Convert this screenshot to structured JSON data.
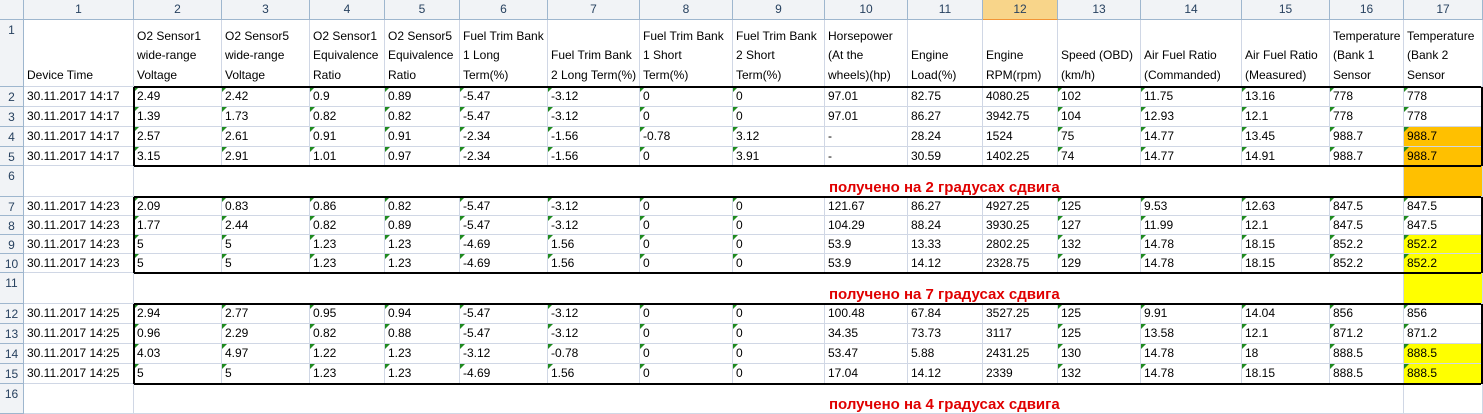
{
  "spreadsheet": {
    "column_numbers": [
      "1",
      "2",
      "3",
      "4",
      "5",
      "6",
      "7",
      "8",
      "9",
      "10",
      "11",
      "12",
      "13",
      "14",
      "15",
      "16",
      "17"
    ],
    "selected_column": "12",
    "row_numbers": [
      "1",
      "2",
      "3",
      "4",
      "5",
      "6",
      "7",
      "8",
      "9",
      "10",
      "11",
      "12",
      "13",
      "14",
      "15",
      "16"
    ],
    "headers": [
      "Device Time",
      "O2 Sensor1 wide-range Voltage",
      "O2 Sensor5 wide-range Voltage",
      "O2 Sensor1 Equivalence Ratio",
      "O2 Sensor5 Equivalence Ratio",
      "Fuel Trim Bank 1 Long Term(%)",
      "Fuel Trim Bank 2 Long Term(%)",
      "Fuel Trim Bank 1 Short Term(%)",
      "Fuel Trim Bank 2 Short Term(%)",
      "Horsepower (At the wheels)(hp)",
      "Engine Load(%)",
      "Engine RPM(rpm)",
      "Speed (OBD) (km/h)",
      "Air Fuel Ratio (Commanded)",
      "Air Fuel Ratio (Measured)",
      "Temperature (Bank 1 Sensor",
      "Temperature (Bank 2 Sensor"
    ],
    "data_rows": [
      {
        "row": "2",
        "cells": [
          "30.11.2017 14:17",
          "2.49",
          "2.42",
          "0.9",
          "0.89",
          "-5.47",
          "-3.12",
          "0",
          "0",
          "97.01",
          "82.75",
          "4080.25",
          "102",
          "11.75",
          "13.16",
          "778",
          "778"
        ]
      },
      {
        "row": "3",
        "cells": [
          "30.11.2017 14:17",
          "1.39",
          "1.73",
          "0.82",
          "0.82",
          "-5.47",
          "-3.12",
          "0",
          "0",
          "97.01",
          "86.27",
          "3942.75",
          "104",
          "12.93",
          "12.1",
          "778",
          "778"
        ]
      },
      {
        "row": "4",
        "cells": [
          "30.11.2017 14:17",
          "2.57",
          "2.61",
          "0.91",
          "0.91",
          "-2.34",
          "-1.56",
          "-0.78",
          "3.12",
          "-",
          "28.24",
          "1524",
          "75",
          "14.77",
          "13.45",
          "988.7",
          "988.7"
        ]
      },
      {
        "row": "5",
        "cells": [
          "30.11.2017 14:17",
          "3.15",
          "2.91",
          "1.01",
          "0.97",
          "-2.34",
          "-1.56",
          "0",
          "3.91",
          "-",
          "30.59",
          "1402.25",
          "74",
          "14.77",
          "14.91",
          "988.7",
          "988.7"
        ]
      },
      {
        "row": "7",
        "cells": [
          "30.11.2017 14:23",
          "2.09",
          "0.83",
          "0.86",
          "0.82",
          "-5.47",
          "-3.12",
          "0",
          "0",
          "121.67",
          "86.27",
          "4927.25",
          "125",
          "9.53",
          "12.63",
          "847.5",
          "847.5"
        ]
      },
      {
        "row": "8",
        "cells": [
          "30.11.2017 14:23",
          "1.77",
          "2.44",
          "0.82",
          "0.89",
          "-5.47",
          "-3.12",
          "0",
          "0",
          "104.29",
          "88.24",
          "3930.25",
          "127",
          "11.99",
          "12.1",
          "847.5",
          "847.5"
        ]
      },
      {
        "row": "9",
        "cells": [
          "30.11.2017 14:23",
          "5",
          "5",
          "1.23",
          "1.23",
          "-4.69",
          "1.56",
          "0",
          "0",
          "53.9",
          "13.33",
          "2802.25",
          "132",
          "14.78",
          "18.15",
          "852.2",
          "852.2"
        ]
      },
      {
        "row": "10",
        "cells": [
          "30.11.2017 14:23",
          "5",
          "5",
          "1.23",
          "1.23",
          "-4.69",
          "1.56",
          "0",
          "0",
          "53.9",
          "14.12",
          "2328.75",
          "129",
          "14.78",
          "18.15",
          "852.2",
          "852.2"
        ]
      },
      {
        "row": "12",
        "cells": [
          "30.11.2017 14:25",
          "2.94",
          "2.77",
          "0.95",
          "0.94",
          "-5.47",
          "-3.12",
          "0",
          "0",
          "100.48",
          "67.84",
          "3527.25",
          "125",
          "9.91",
          "14.04",
          "856",
          "856"
        ]
      },
      {
        "row": "13",
        "cells": [
          "30.11.2017 14:25",
          "0.96",
          "2.29",
          "0.82",
          "0.88",
          "-5.47",
          "-3.12",
          "0",
          "0",
          "34.35",
          "73.73",
          "3117",
          "125",
          "13.58",
          "12.1",
          "871.2",
          "871.2"
        ]
      },
      {
        "row": "14",
        "cells": [
          "30.11.2017 14:25",
          "4.03",
          "4.97",
          "1.22",
          "1.23",
          "-3.12",
          "-0.78",
          "0",
          "0",
          "53.47",
          "5.88",
          "2431.25",
          "130",
          "14.78",
          "18",
          "888.5",
          "888.5"
        ]
      },
      {
        "row": "15",
        "cells": [
          "30.11.2017 14:25",
          "5",
          "5",
          "1.23",
          "1.23",
          "-4.69",
          "1.56",
          "0",
          "0",
          "17.04",
          "14.12",
          "2339",
          "132",
          "14.78",
          "18.15",
          "888.5",
          "888.5"
        ]
      }
    ],
    "banners": [
      {
        "row": "6",
        "text": "получено на 2 градусах сдвига"
      },
      {
        "row": "11",
        "text": "получено на 7 градусах сдвига"
      },
      {
        "row": "16",
        "text": "получено на 4 градусах сдвига"
      }
    ],
    "colors": {
      "orange_highlight": "#ffc000",
      "yellow_highlight": "#ffff00",
      "banner_text": "#e00000",
      "number_stored_as_text_marker": "#1f8a1f"
    }
  }
}
